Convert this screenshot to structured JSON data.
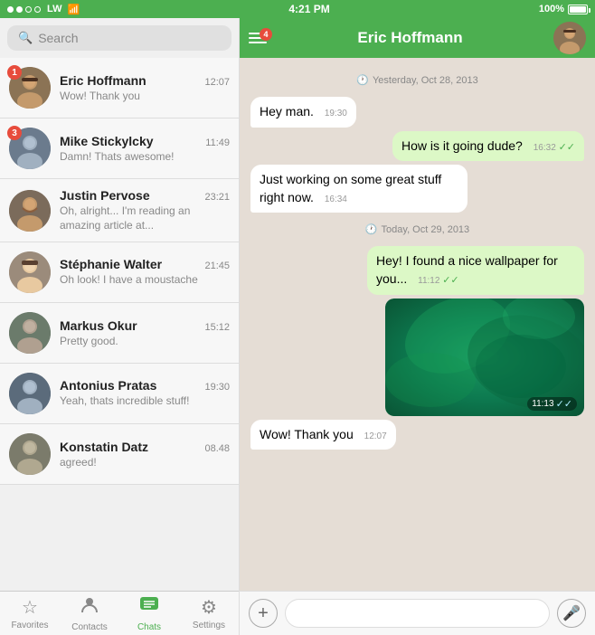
{
  "statusBar": {
    "dots": [
      "filled",
      "filled",
      "empty",
      "empty"
    ],
    "carrier": "LW",
    "time": "4:21 PM",
    "battery": "100%"
  },
  "search": {
    "placeholder": "Search"
  },
  "contacts": [
    {
      "id": 1,
      "name": "Eric Hoffmann",
      "time": "12:07",
      "preview": "Wow! Thank you",
      "badge": 1,
      "avatar": "👤"
    },
    {
      "id": 2,
      "name": "Mike Stickylcky",
      "time": "11:49",
      "preview": "Damn! Thats awesome!",
      "badge": 3,
      "avatar": "🧍"
    },
    {
      "id": 3,
      "name": "Justin Pervose",
      "time": "23:21",
      "preview": "Oh, alright... I'm reading an amazing article at...",
      "badge": 0,
      "avatar": "🧔"
    },
    {
      "id": 4,
      "name": "Stéphanie Walter",
      "time": "21:45",
      "preview": "Oh look! I have a moustache",
      "badge": 0,
      "avatar": "👩"
    },
    {
      "id": 5,
      "name": "Markus Okur",
      "time": "15:12",
      "preview": "Pretty good.",
      "badge": 0,
      "avatar": "👤"
    },
    {
      "id": 6,
      "name": "Antonius Pratas",
      "time": "19:30",
      "preview": "Yeah, thats incredible stuff!",
      "badge": 0,
      "avatar": "👤"
    },
    {
      "id": 7,
      "name": "Konstatin Datz",
      "time": "08.48",
      "preview": "agreed!",
      "badge": 0,
      "avatar": "👤"
    }
  ],
  "tabs": [
    {
      "id": "favorites",
      "label": "Favorites",
      "icon": "★"
    },
    {
      "id": "contacts",
      "label": "Contacts",
      "icon": "👤"
    },
    {
      "id": "chats",
      "label": "Chats",
      "icon": "💬",
      "active": true
    },
    {
      "id": "settings",
      "label": "Settings",
      "icon": "⚙"
    }
  ],
  "chatHeader": {
    "name": "Eric Hoffmann",
    "notifCount": "4"
  },
  "messages": [
    {
      "id": 1,
      "type": "date",
      "text": "Yesterday, Oct 28, 2013"
    },
    {
      "id": 2,
      "type": "received",
      "text": "Hey man.",
      "time": "19:30"
    },
    {
      "id": 3,
      "type": "sent",
      "text": "How is it going dude?",
      "time": "16:32",
      "checks": "✓✓"
    },
    {
      "id": 4,
      "type": "received",
      "text": "Just working on some great stuff right now.",
      "time": "16:34"
    },
    {
      "id": 5,
      "type": "date",
      "text": "Today, Oct 29, 2013"
    },
    {
      "id": 6,
      "type": "sent",
      "text": "Hey! I found a nice wallpaper for you...",
      "time": "11:12",
      "checks": "✓✓"
    },
    {
      "id": 7,
      "type": "image",
      "time": "11:13",
      "checks": "✓✓"
    },
    {
      "id": 8,
      "type": "received",
      "text": "Wow! Thank you",
      "time": "12:07"
    }
  ],
  "inputBar": {
    "placeholder": ""
  }
}
